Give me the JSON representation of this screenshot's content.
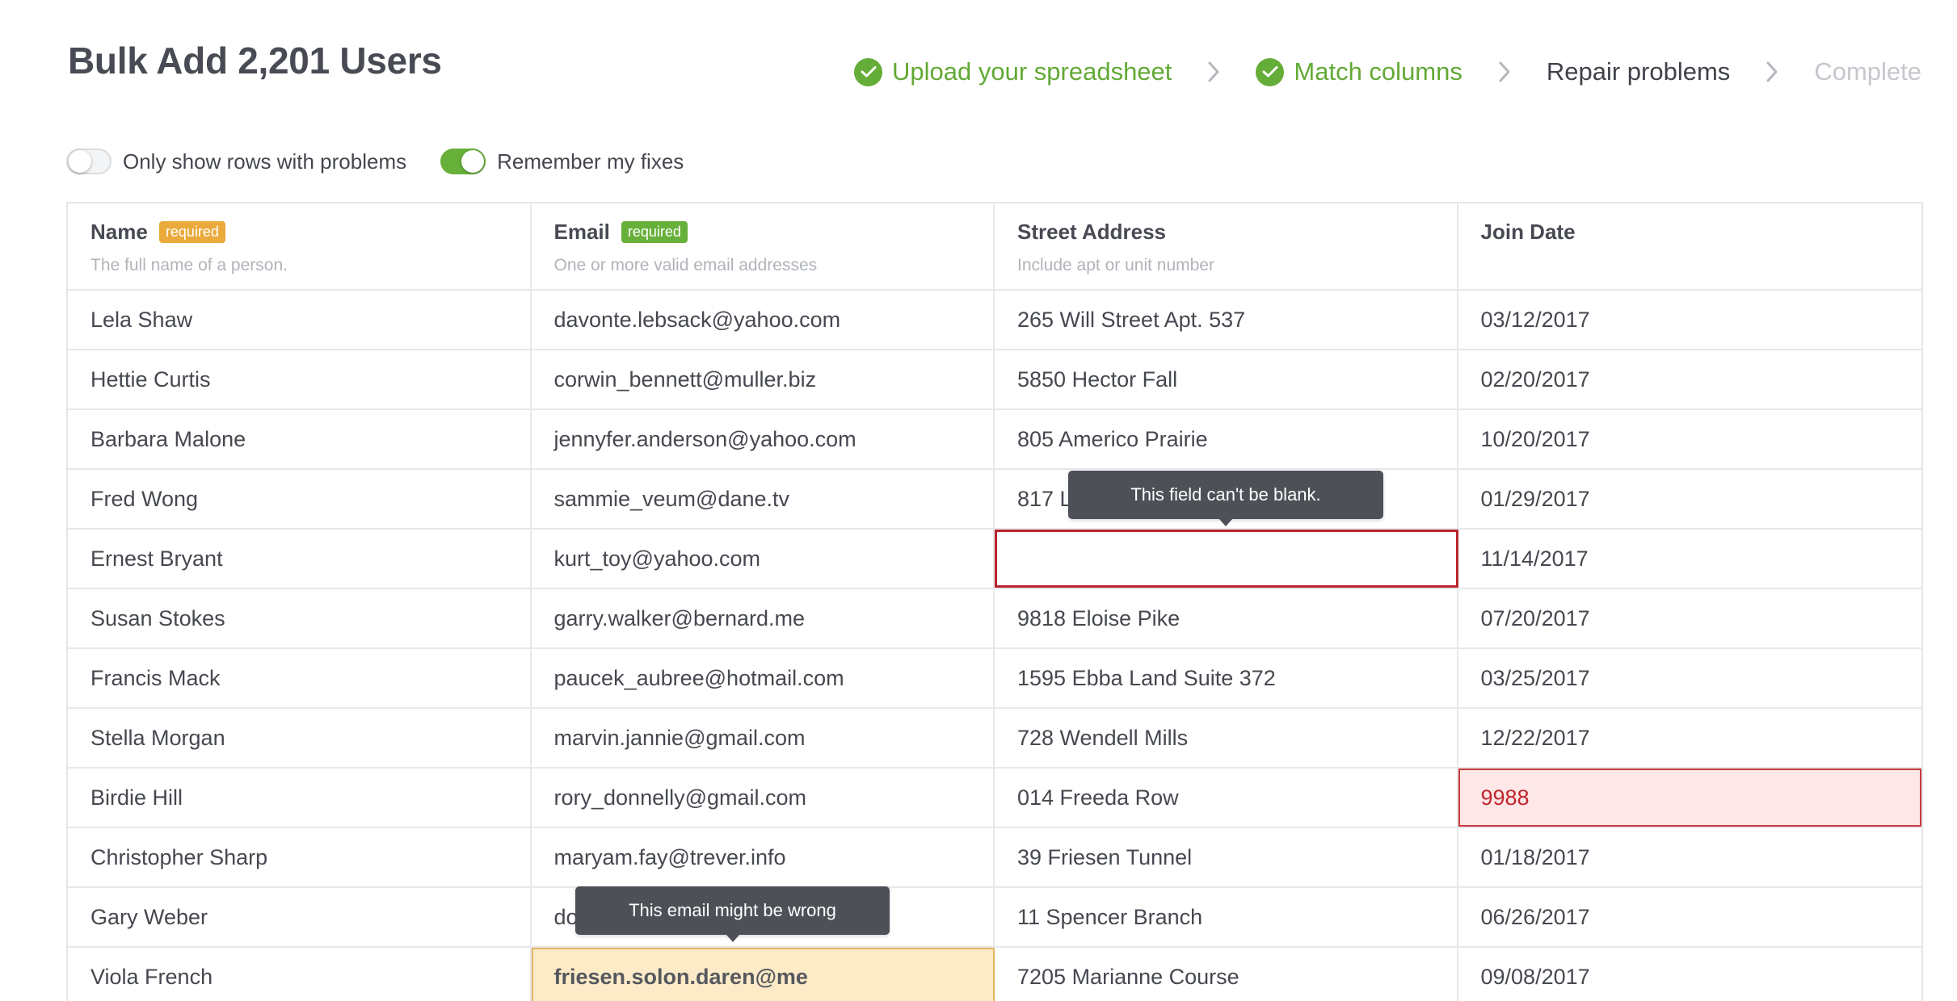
{
  "title": "Bulk Add 2,201 Users",
  "steps": [
    {
      "label": "Upload your spreadsheet",
      "state": "done"
    },
    {
      "label": "Match columns",
      "state": "done"
    },
    {
      "label": "Repair problems",
      "state": "current"
    },
    {
      "label": "Complete",
      "state": "todo"
    }
  ],
  "toggles": {
    "problems_only": {
      "label": "Only show rows with problems",
      "on": false
    },
    "remember_fixes": {
      "label": "Remember my fixes",
      "on": true
    }
  },
  "columns": [
    {
      "title": "Name",
      "badge": "required",
      "description": "The full name of a person."
    },
    {
      "title": "Email",
      "badge": "required",
      "description": "One or more valid email addresses"
    },
    {
      "title": "Street Address",
      "badge": "",
      "description": "Include apt or unit number"
    },
    {
      "title": "Join Date",
      "badge": "",
      "description": ""
    }
  ],
  "rows": [
    [
      "Lela Shaw",
      "davonte.lebsack@yahoo.com",
      "265 Will Street Apt. 537",
      "03/12/2017"
    ],
    [
      "Hettie Curtis",
      "corwin_bennett@muller.biz",
      "5850 Hector Fall",
      "02/20/2017"
    ],
    [
      "Barbara Malone",
      "jennyfer.anderson@yahoo.com",
      "805 Americo Prairie",
      "10/20/2017"
    ],
    [
      "Fred Wong",
      "sammie_veum@dane.tv",
      "817 L",
      "01/29/2017"
    ],
    [
      "Ernest Bryant",
      "kurt_toy@yahoo.com",
      "",
      "11/14/2017"
    ],
    [
      "Susan Stokes",
      "garry.walker@bernard.me",
      "9818 Eloise Pike",
      "07/20/2017"
    ],
    [
      "Francis Mack",
      "paucek_aubree@hotmail.com",
      "1595 Ebba Land Suite 372",
      "03/25/2017"
    ],
    [
      "Stella Morgan",
      "marvin.jannie@gmail.com",
      "728 Wendell Mills",
      "12/22/2017"
    ],
    [
      "Birdie Hill",
      "rory_donnelly@gmail.com",
      "014 Freeda Row",
      "9988"
    ],
    [
      "Christopher Sharp",
      "maryam.fay@trever.info",
      "39 Friesen Tunnel",
      "01/18/2017"
    ],
    [
      "Gary Weber",
      "do",
      "11 Spencer Branch",
      "06/26/2017"
    ],
    [
      "Viola French",
      "friesen.solon.daren@me",
      "7205 Marianne Course",
      "09/08/2017"
    ]
  ],
  "tooltips": {
    "blank_field": "This field can't be blank.",
    "email_warning": "This email might be wrong"
  },
  "colors": {
    "success": "#64ad38",
    "error": "#b8252d",
    "warning": "#e5b55e",
    "badge_orange": "#ebaa3c"
  },
  "icons": {
    "done": "check-circle-icon",
    "separator": "chevron-right-icon"
  }
}
